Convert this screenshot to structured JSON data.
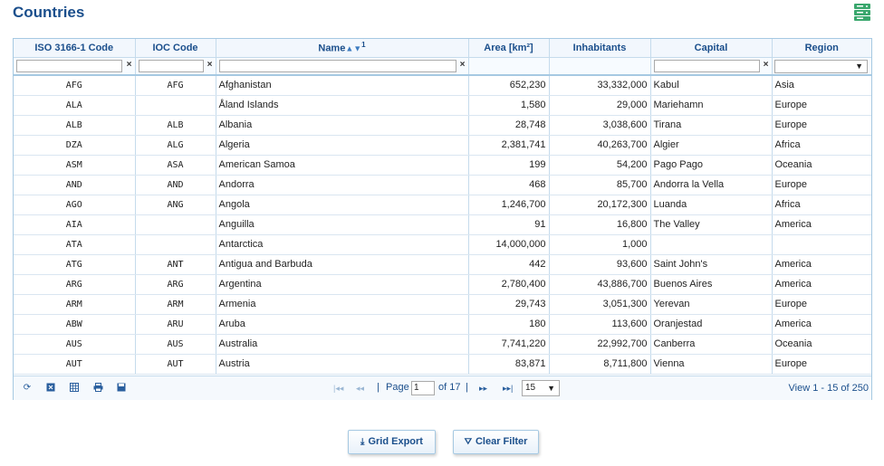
{
  "title": "Countries",
  "columns": [
    {
      "key": "iso",
      "label": "ISO 3166-1 Code"
    },
    {
      "key": "ioc",
      "label": "IOC Code"
    },
    {
      "key": "name",
      "label": "Name",
      "sort_order": "1"
    },
    {
      "key": "area",
      "label": "Area [km²]"
    },
    {
      "key": "inh",
      "label": "Inhabitants"
    },
    {
      "key": "capital",
      "label": "Capital"
    },
    {
      "key": "region",
      "label": "Region"
    }
  ],
  "filters": {
    "clear_symbol": "×",
    "region_selected": ""
  },
  "rows": [
    {
      "iso": "AFG",
      "ioc": "AFG",
      "name": "Afghanistan",
      "area": "652,230",
      "inh": "33,332,000",
      "capital": "Kabul",
      "region": "Asia"
    },
    {
      "iso": "ALA",
      "ioc": "",
      "name": "Åland Islands",
      "area": "1,580",
      "inh": "29,000",
      "capital": "Mariehamn",
      "region": "Europe"
    },
    {
      "iso": "ALB",
      "ioc": "ALB",
      "name": "Albania",
      "area": "28,748",
      "inh": "3,038,600",
      "capital": "Tirana",
      "region": "Europe"
    },
    {
      "iso": "DZA",
      "ioc": "ALG",
      "name": "Algeria",
      "area": "2,381,741",
      "inh": "40,263,700",
      "capital": "Algier",
      "region": "Africa"
    },
    {
      "iso": "ASM",
      "ioc": "ASA",
      "name": "American Samoa",
      "area": "199",
      "inh": "54,200",
      "capital": "Pago Pago",
      "region": "Oceania"
    },
    {
      "iso": "AND",
      "ioc": "AND",
      "name": "Andorra",
      "area": "468",
      "inh": "85,700",
      "capital": "Andorra la Vella",
      "region": "Europe"
    },
    {
      "iso": "AGO",
      "ioc": "ANG",
      "name": "Angola",
      "area": "1,246,700",
      "inh": "20,172,300",
      "capital": "Luanda",
      "region": "Africa"
    },
    {
      "iso": "AIA",
      "ioc": "",
      "name": "Anguilla",
      "area": "91",
      "inh": "16,800",
      "capital": "The Valley",
      "region": "America"
    },
    {
      "iso": "ATA",
      "ioc": "",
      "name": "Antarctica",
      "area": "14,000,000",
      "inh": "1,000",
      "capital": "",
      "region": ""
    },
    {
      "iso": "ATG",
      "ioc": "ANT",
      "name": "Antigua and Barbuda",
      "area": "442",
      "inh": "93,600",
      "capital": "Saint John's",
      "region": "America"
    },
    {
      "iso": "ARG",
      "ioc": "ARG",
      "name": "Argentina",
      "area": "2,780,400",
      "inh": "43,886,700",
      "capital": "Buenos Aires",
      "region": "America"
    },
    {
      "iso": "ARM",
      "ioc": "ARM",
      "name": "Armenia",
      "area": "29,743",
      "inh": "3,051,300",
      "capital": "Yerevan",
      "region": "Europe"
    },
    {
      "iso": "ABW",
      "ioc": "ARU",
      "name": "Aruba",
      "area": "180",
      "inh": "113,600",
      "capital": "Oranjestad",
      "region": "America"
    },
    {
      "iso": "AUS",
      "ioc": "AUS",
      "name": "Australia",
      "area": "7,741,220",
      "inh": "22,992,700",
      "capital": "Canberra",
      "region": "Oceania"
    },
    {
      "iso": "AUT",
      "ioc": "AUT",
      "name": "Austria",
      "area": "83,871",
      "inh": "8,711,800",
      "capital": "Vienna",
      "region": "Europe"
    }
  ],
  "pager": {
    "page_label": "Page",
    "page_value": "1",
    "of_label": "of 17",
    "page_size": "15",
    "view_text": "View 1 - 15 of 250",
    "sep": "|"
  },
  "buttons": {
    "export": "Grid Export",
    "clear_filter": "Clear Filter"
  },
  "icons": {
    "database": "database-icon",
    "refresh": "refresh-icon",
    "clear": "clear-icon",
    "columns": "columns-icon",
    "print": "print-icon",
    "save": "save-icon",
    "first": "first-page-icon",
    "prev": "prev-page-icon",
    "next": "next-page-icon",
    "last": "last-page-icon",
    "export": "download-icon",
    "filter": "filter-clear-icon"
  },
  "colors": {
    "accent": "#1b4f8c",
    "border": "#a6c9e2",
    "icon_green": "#3aa76d"
  }
}
